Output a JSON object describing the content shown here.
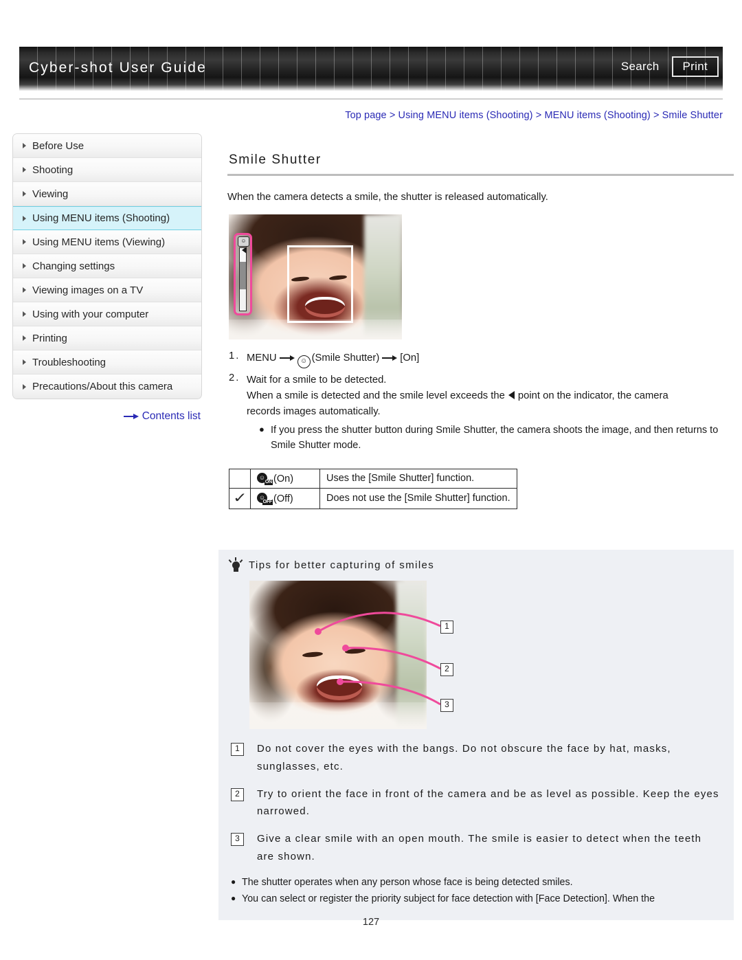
{
  "header": {
    "title": "Cyber-shot User Guide",
    "search_label": "Search",
    "print_label": "Print"
  },
  "breadcrumb": {
    "text": "Top page > Using MENU items (Shooting) > MENU items (Shooting) > Smile Shutter"
  },
  "sidebar": {
    "items": [
      {
        "label": "Before Use"
      },
      {
        "label": "Shooting"
      },
      {
        "label": "Viewing"
      },
      {
        "label": "Using MENU items (Shooting)"
      },
      {
        "label": "Using MENU items (Viewing)"
      },
      {
        "label": "Changing settings"
      },
      {
        "label": "Viewing images on a TV"
      },
      {
        "label": "Using with your computer"
      },
      {
        "label": "Printing"
      },
      {
        "label": "Troubleshooting"
      },
      {
        "label": "Precautions/About this camera"
      }
    ],
    "active_index": 3,
    "contents_list_label": "Contents list"
  },
  "main": {
    "title": "Smile Shutter",
    "intro": "When the camera detects a smile, the shutter is released automatically.",
    "steps": [
      {
        "number": "1.",
        "prefix": "MENU",
        "icon_label": "(Smile Shutter)",
        "suffix": "[On]"
      },
      {
        "number": "2.",
        "line1": "Wait for a smile to be detected.",
        "line2_before": "When a smile is detected and the smile level exceeds the",
        "line2_after": "point on the indicator, the camera",
        "line3": "records images automatically.",
        "bullet": "If you press the shutter button during Smile Shutter, the camera shoots the image, and then returns to Smile Shutter mode."
      }
    ],
    "options_table": {
      "rows": [
        {
          "checked": "",
          "icon_badge": "ON",
          "icon_label": "(On)",
          "description": "Uses the [Smile Shutter] function."
        },
        {
          "checked": "✓",
          "icon_badge": "OFF",
          "icon_label": "(Off)",
          "description": "Does not use the [Smile Shutter] function."
        }
      ]
    }
  },
  "tips": {
    "heading": "Tips for better capturing of smiles",
    "callouts": [
      "1",
      "2",
      "3"
    ],
    "items": [
      {
        "badge": "1",
        "text": "Do not cover the eyes with the bangs. Do not obscure the face by hat, masks, sunglasses, etc."
      },
      {
        "badge": "2",
        "text": "Try to orient the face in front of the camera and be as level as possible. Keep the eyes narrowed."
      },
      {
        "badge": "3",
        "text": "Give a clear smile with an open mouth. The smile is easier to detect when the teeth are shown."
      }
    ],
    "notes": [
      "The shutter operates when any person whose face is being detected smiles.",
      "You can select or register the priority subject for face detection with [Face Detection]. When the"
    ]
  },
  "footer": {
    "page_number": "127"
  },
  "colors": {
    "link": "#2a2ab5",
    "active_nav_bg": "#d6f3fa",
    "active_nav_border": "#6fcfe2",
    "callout_pink": "#ef4a9b",
    "tips_panel_bg": "#eef0f4"
  }
}
